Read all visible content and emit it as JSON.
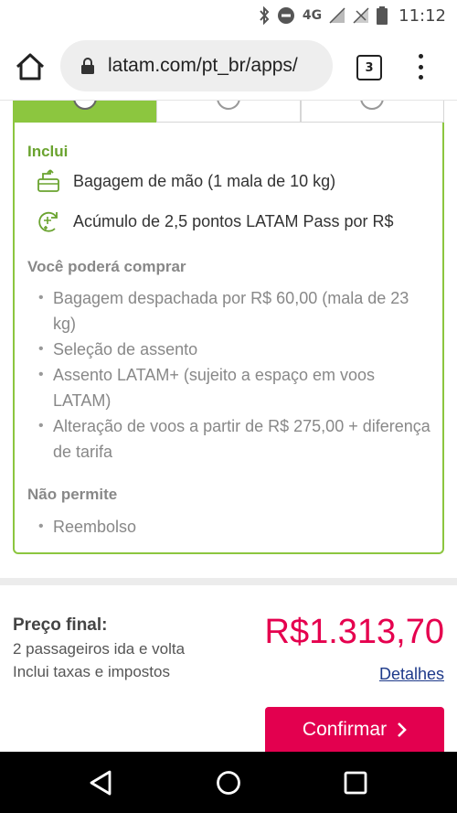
{
  "status": {
    "network": "4G",
    "time": "11:12"
  },
  "browser": {
    "url": "latam.com/pt_br/apps/",
    "tab_count": "3"
  },
  "card": {
    "included_title": "Inclui",
    "included": [
      {
        "icon": "carry-on-bag-icon",
        "text": "Bagagem de mão (1 mala de 10 kg)"
      },
      {
        "icon": "points-accrual-icon",
        "text": "Acúmulo de 2,5 pontos LATAM Pass por R$"
      }
    ],
    "purchasable_title": "Você poderá comprar",
    "purchasable": [
      "Bagagem despachada por R$ 60,00 (mala de 23 kg)",
      "Seleção de assento",
      "Assento LATAM+ (sujeito a espaço em voos LATAM)",
      "Alteração de voos a partir de R$ 275,00 + diferença de tarifa"
    ],
    "not_allowed_title": "Não permite",
    "not_allowed": [
      "Reembolso"
    ]
  },
  "price": {
    "label": "Preço final:",
    "passengers": "2 passageiros ida e volta",
    "taxes": "Inclui taxas e impostos",
    "amount": "R$1.313,70",
    "details_link": "Detalhes",
    "confirm_label": "Confirmar"
  },
  "colors": {
    "accent_green": "#8cc63f",
    "price_red": "#e5004e",
    "link_blue": "#1e3a8a"
  }
}
